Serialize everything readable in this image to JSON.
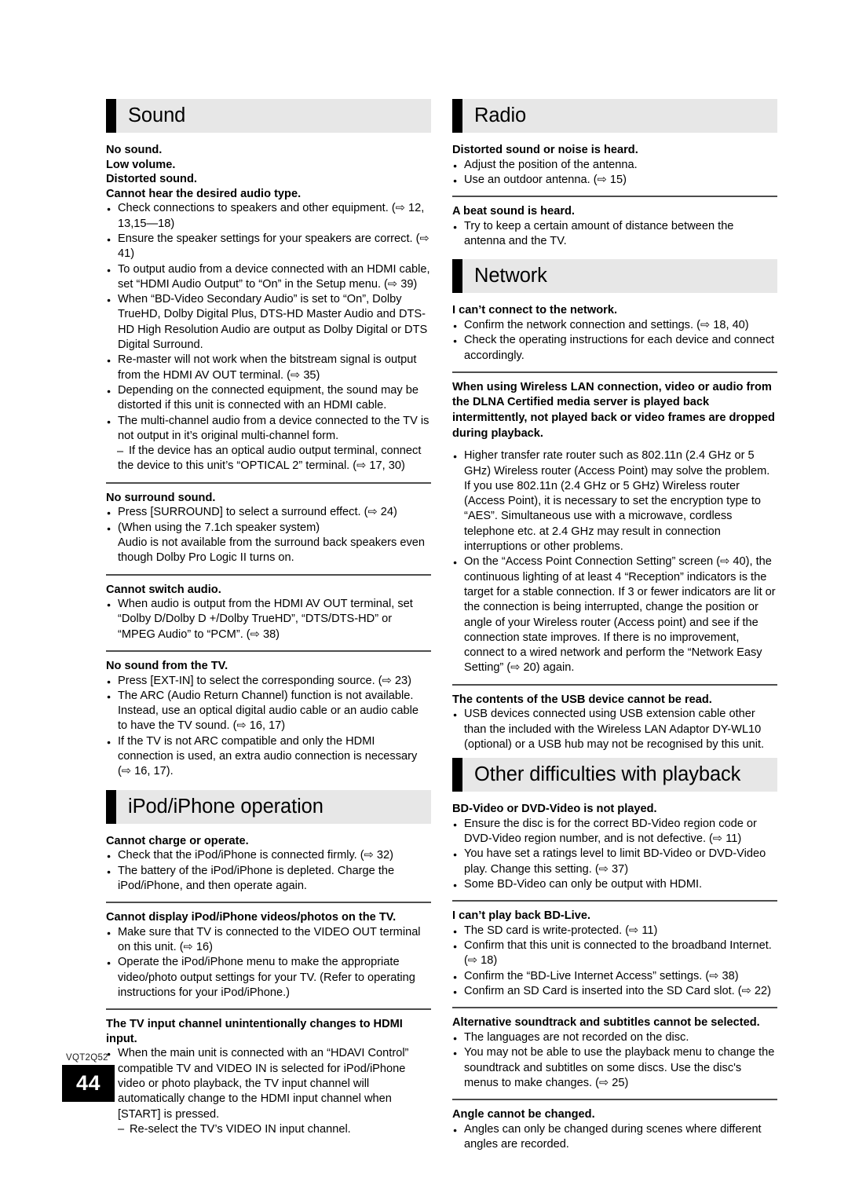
{
  "document": {
    "code": "VQT2Q52",
    "page_number": "44"
  },
  "left_column": {
    "sections": [
      {
        "id": "sound",
        "header": "Sound",
        "blocks": [
          {
            "headings": [
              "No sound.",
              "Low volume.",
              "Distorted sound.",
              "Cannot hear the desired audio type."
            ],
            "bullets": [
              "Check connections to speakers and other equipment. (⇨ 12, 13,15—18)",
              "Ensure the speaker settings for your speakers are correct. (⇨ 41)",
              "To output audio from a device connected with an HDMI cable, set “HDMI Audio Output” to “On” in the Setup menu. (⇨ 39)",
              "When “BD-Video Secondary Audio” is set to “On”, Dolby TrueHD, Dolby Digital Plus, DTS-HD Master Audio and DTS-HD High Resolution Audio are output as Dolby Digital or DTS Digital Surround.",
              "Re-master will not work when the bitstream signal is output from the HDMI AV OUT terminal. (⇨ 35)",
              "Depending on the connected equipment, the sound may be distorted if this unit is connected with an HDMI cable.",
              "The multi-channel audio from a device connected to the TV is not output in it’s original multi-channel form."
            ],
            "subdash": "If the device has an optical audio output terminal, connect the device to this unit’s “OPTICAL 2” terminal. (⇨ 17, 30)"
          },
          {
            "headings": [
              "No surround sound."
            ],
            "bullets": [
              "Press [SURROUND] to select a surround effect. (⇨ 24)",
              "(When using the 7.1ch speaker system)"
            ],
            "continuation": "Audio is not available from the surround back speakers even though Dolby Pro Logic II turns on."
          },
          {
            "headings": [
              "Cannot switch audio."
            ],
            "bullets": [
              "When audio is output from the HDMI AV OUT terminal, set “Dolby D/Dolby D +/Dolby TrueHD”, “DTS/DTS-HD” or “MPEG Audio” to “PCM”. (⇨ 38)"
            ]
          },
          {
            "headings": [
              "No sound from the TV."
            ],
            "bullets": [
              "Press [EXT-IN] to select the corresponding source. (⇨ 23)",
              "The ARC (Audio Return Channel) function is not available. Instead, use an optical digital audio cable or an audio cable to have the TV sound. (⇨ 16, 17)",
              "If the TV is not ARC compatible and only the HDMI connection is used, an extra audio connection is necessary (⇨ 16, 17)."
            ]
          }
        ]
      },
      {
        "id": "ipod-iphone-operation",
        "header": "iPod/iPhone operation",
        "blocks": [
          {
            "headings": [
              "Cannot charge or operate."
            ],
            "bullets": [
              "Check that the iPod/iPhone is connected firmly. (⇨ 32)",
              "The battery of the iPod/iPhone is depleted. Charge the iPod/iPhone, and then operate again."
            ]
          },
          {
            "headings": [
              "Cannot display iPod/iPhone videos/photos on the TV."
            ],
            "bullets": [
              "Make sure that TV is connected to the VIDEO OUT terminal on this unit. (⇨ 16)",
              "Operate the iPod/iPhone menu to make the appropriate video/photo output settings for your TV. (Refer to operating instructions for your iPod/iPhone.)"
            ]
          },
          {
            "headings": [
              "The TV input channel unintentionally changes to HDMI input."
            ],
            "bullets": [
              "When the main unit is connected with an “HDAVI Control” compatible TV and VIDEO IN is selected for iPod/iPhone video or photo playback, the TV input channel will automatically change to the HDMI input channel when [START] is pressed."
            ],
            "subdash": "Re-select the TV’s VIDEO IN input channel."
          }
        ]
      }
    ]
  },
  "right_column": {
    "sections": [
      {
        "id": "radio",
        "header": "Radio",
        "blocks": [
          {
            "headings": [
              "Distorted sound or noise is heard."
            ],
            "bullets": [
              "Adjust the position of the antenna.",
              "Use an outdoor antenna. (⇨ 15)"
            ]
          },
          {
            "headings": [
              "A beat sound is heard."
            ],
            "bullets": [
              "Try to keep a certain amount of distance between the antenna and the TV."
            ]
          }
        ]
      },
      {
        "id": "network",
        "header": "Network",
        "blocks": [
          {
            "headings": [
              "I can’t connect to the network."
            ],
            "bullets": [
              "Confirm the network connection and settings. (⇨ 18, 40)",
              "Check the operating instructions for each device and connect accordingly."
            ]
          },
          {
            "bold_para": "When using Wireless LAN connection, video or audio from the DLNA Certified media server is played back intermittently, not played back or video frames are dropped during playback.",
            "bullets": [
              "Higher transfer rate router such as 802.11n (2.4 GHz or 5 GHz) Wireless router (Access Point) may solve the problem. If you use 802.11n (2.4 GHz or 5 GHz) Wireless router (Access Point), it is necessary to set the encryption type to “AES”. Simultaneous use with a microwave, cordless telephone etc. at 2.4 GHz may result in connection interruptions or other problems.",
              "On the “Access Point Connection Setting” screen (⇨ 40), the continuous lighting of at least 4 “Reception” indicators is the target for a stable connection. If 3 or fewer indicators are lit or the connection is being interrupted, change the position or angle of your Wireless router (Access point) and see if the connection state improves. If there is no improvement, connect to a wired network and perform the “Network Easy Setting” (⇨ 20) again."
            ]
          },
          {
            "headings": [
              "The contents of the USB device cannot be read."
            ],
            "bullets": [
              "USB devices connected using USB extension cable other than the included with the Wireless LAN Adaptor DY-WL10 (optional) or a USB hub may not be recognised by this unit."
            ]
          }
        ]
      },
      {
        "id": "other-difficulties-with-playback",
        "header": "Other difficulties with playback",
        "blocks": [
          {
            "headings": [
              "BD-Video or DVD-Video is not played."
            ],
            "bullets": [
              "Ensure the disc is for the correct BD-Video region code or DVD-Video region number, and is not defective. (⇨ 11)",
              "You have set a ratings level to limit BD-Video or DVD-Video play. Change this setting. (⇨ 37)",
              "Some BD-Video can only be output with HDMI."
            ]
          },
          {
            "headings": [
              "I can’t play back BD-Live."
            ],
            "bullets": [
              "The SD card is write-protected. (⇨ 11)",
              "Confirm that this unit is connected to the broadband Internet. (⇨ 18)",
              "Confirm the “BD-Live Internet Access” settings. (⇨ 38)",
              "Confirm an SD Card is inserted into the SD Card slot. (⇨ 22)"
            ]
          },
          {
            "headings": [
              "Alternative soundtrack and subtitles cannot be selected."
            ],
            "bullets": [
              "The languages are not recorded on the disc.",
              "You may not be able to use the playback menu to change the soundtrack and subtitles on some discs. Use the disc's menus to make changes. (⇨ 25)"
            ]
          },
          {
            "headings": [
              "Angle cannot be changed."
            ],
            "bullets": [
              "Angles can only be changed during scenes where different angles are recorded."
            ]
          }
        ]
      }
    ]
  }
}
